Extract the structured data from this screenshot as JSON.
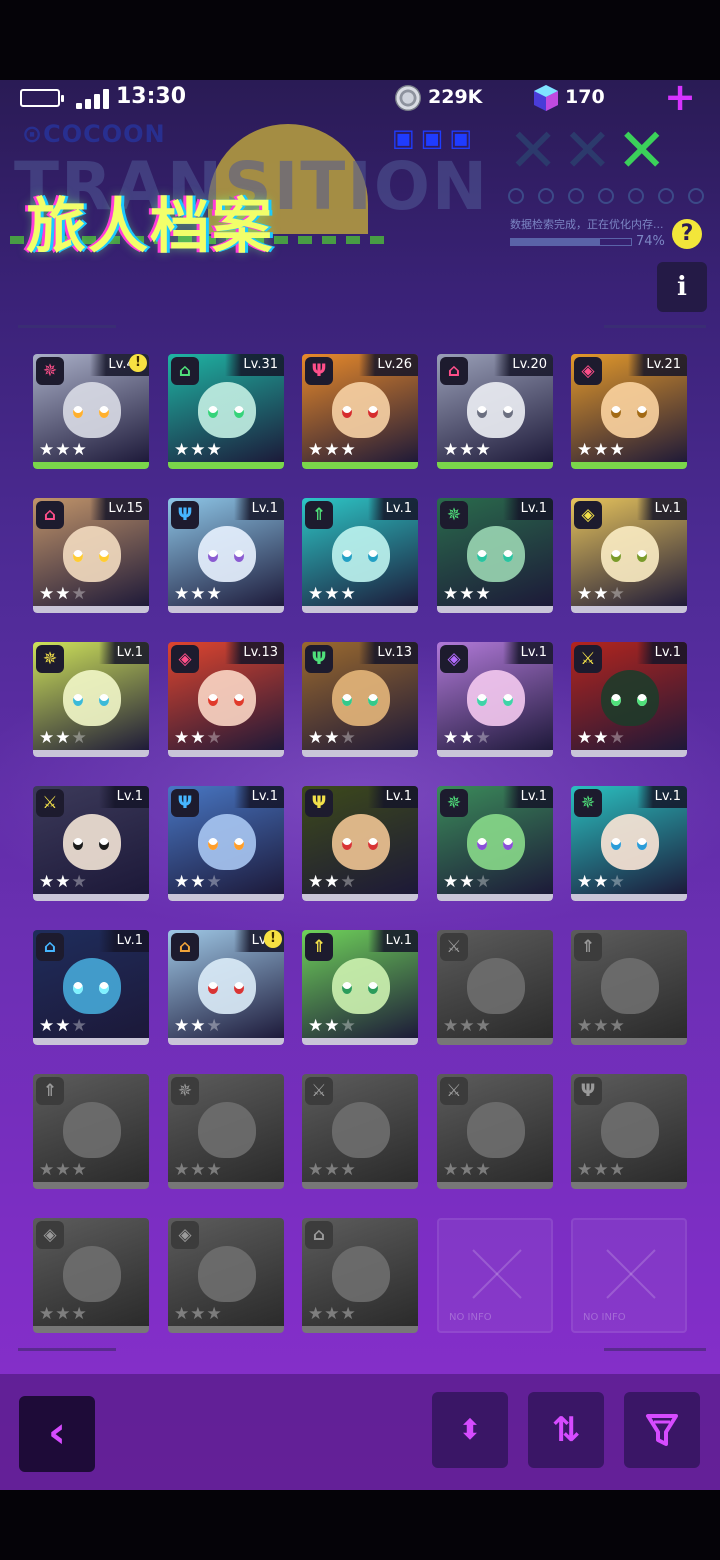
{
  "status_bar": {
    "time": "13:30",
    "coins": "229K",
    "gems": "170",
    "plus_label": "+"
  },
  "header": {
    "title": "旅人档案",
    "bg_word": "TRANSITION",
    "cocoon_label": "COCOON",
    "loading_text": "数据检索完成，正在优化内存...",
    "loading_percent": "74%",
    "loading_fraction": 0.74,
    "help_label": "?",
    "info_label": "i"
  },
  "empty_label": "NO INFO",
  "characters": [
    {
      "level": "Lv.45",
      "stars": 3,
      "role": "✵",
      "role_color": "#ff4f8a",
      "hue": "#aab0c8",
      "face": "#d9dbe6",
      "eyes": "#ffb02e",
      "alert": true,
      "green": true
    },
    {
      "level": "Lv.31",
      "stars": 3,
      "role": "⌂",
      "role_color": "#4fe07a",
      "hue": "#1fb5a4",
      "face": "#c3efe3",
      "eyes": "#35d37a",
      "alert": false,
      "green": true
    },
    {
      "level": "Lv.26",
      "stars": 3,
      "role": "Ψ",
      "role_color": "#ff4f8a",
      "hue": "#e88a2a",
      "face": "#f7d2a5",
      "eyes": "#d62c2c",
      "alert": false,
      "green": true
    },
    {
      "level": "Lv.20",
      "stars": 3,
      "role": "⌂",
      "role_color": "#ff4f8a",
      "hue": "#9aa0b8",
      "face": "#eceef4",
      "eyes": "#6b6f80",
      "alert": false,
      "green": true
    },
    {
      "level": "Lv.21",
      "stars": 3,
      "role": "◈",
      "role_color": "#ff4f8a",
      "hue": "#e59a2a",
      "face": "#fbd3a0",
      "eyes": "#a36a14",
      "alert": false,
      "green": true
    },
    {
      "level": "Lv.15",
      "stars": 2,
      "role": "⌂",
      "role_color": "#ff4f8a",
      "hue": "#c2956a",
      "face": "#f3dcc0",
      "eyes": "#ffcc33",
      "alert": false,
      "green": false
    },
    {
      "level": "Lv.1",
      "stars": 3,
      "role": "Ψ",
      "role_color": "#46b6ff",
      "hue": "#8ec7e8",
      "face": "#e8f2ff",
      "eyes": "#8a5bd1",
      "alert": false,
      "green": false
    },
    {
      "level": "Lv.1",
      "stars": 3,
      "role": "⇑",
      "role_color": "#4fe07a",
      "hue": "#2dc7c7",
      "face": "#bff4f0",
      "eyes": "#23a0c4",
      "alert": false,
      "green": false
    },
    {
      "level": "Lv.1",
      "stars": 3,
      "role": "✵",
      "role_color": "#4fe07a",
      "hue": "#2a6b4c",
      "face": "#9ad6b3",
      "eyes": "#2ac4a0",
      "alert": false,
      "green": false
    },
    {
      "level": "Lv.1",
      "stars": 2,
      "role": "◈",
      "role_color": "#f2e04a",
      "hue": "#e7c45c",
      "face": "#fbecc3",
      "eyes": "#7a9b2a",
      "alert": false,
      "green": false
    },
    {
      "level": "Lv.1",
      "stars": 2,
      "role": "✵",
      "role_color": "#f2e04a",
      "hue": "#cfe35a",
      "face": "#f2f7c8",
      "eyes": "#3bbad8",
      "alert": false,
      "green": false
    },
    {
      "level": "Lv.13",
      "stars": 2,
      "role": "◈",
      "role_color": "#ff4f8a",
      "hue": "#e0452e",
      "face": "#fbd6c4",
      "eyes": "#e03a2a",
      "alert": false,
      "green": false
    },
    {
      "level": "Lv.13",
      "stars": 2,
      "role": "Ψ",
      "role_color": "#4fe07a",
      "hue": "#9b6a2e",
      "face": "#e4b67a",
      "eyes": "#34c98a",
      "alert": false,
      "green": false
    },
    {
      "level": "Lv.1",
      "stars": 2,
      "role": "◈",
      "role_color": "#b36bff",
      "hue": "#b27ad9",
      "face": "#f4c9f0",
      "eyes": "#3fd3a8",
      "alert": false,
      "green": false
    },
    {
      "level": "Lv.1",
      "stars": 2,
      "role": "⚔",
      "role_color": "#f2e04a",
      "hue": "#b4251e",
      "face": "#1e3b2a",
      "eyes": "#4fe07a",
      "alert": false,
      "green": false
    },
    {
      "level": "Lv.1",
      "stars": 2,
      "role": "⚔",
      "role_color": "#f2e04a",
      "hue": "#3c3a5a",
      "face": "#f3e4d6",
      "eyes": "#1a1a1a",
      "alert": false,
      "green": false
    },
    {
      "level": "Lv.1",
      "stars": 2,
      "role": "Ψ",
      "role_color": "#46b6ff",
      "hue": "#4877c4",
      "face": "#a9c7f2",
      "eyes": "#ff9e2a",
      "alert": false,
      "green": false
    },
    {
      "level": "Lv.1",
      "stars": 2,
      "role": "Ψ",
      "role_color": "#f2e04a",
      "hue": "#3d4a1a",
      "face": "#f0c493",
      "eyes": "#d83434",
      "alert": false,
      "green": false
    },
    {
      "level": "Lv.1",
      "stars": 2,
      "role": "✵",
      "role_color": "#4fe07a",
      "hue": "#3b8b5a",
      "face": "#88d98a",
      "eyes": "#8a4fd8",
      "alert": false,
      "green": false
    },
    {
      "level": "Lv.1",
      "stars": 2,
      "role": "✵",
      "role_color": "#4fe07a",
      "hue": "#2ac0c0",
      "face": "#fce6d6",
      "eyes": "#2a9cd8",
      "alert": false,
      "green": false
    },
    {
      "level": "Lv.1",
      "stars": 2,
      "role": "⌂",
      "role_color": "#46b6ff",
      "hue": "#1f2d5c",
      "face": "#46a8d8",
      "eyes": "#7ff2ff",
      "alert": false,
      "green": false
    },
    {
      "level": "Lv.1",
      "stars": 2,
      "role": "⌂",
      "role_color": "#f2a43a",
      "hue": "#9fc8e6",
      "face": "#dcecf8",
      "eyes": "#d83434",
      "alert": true,
      "green": false
    },
    {
      "level": "Lv.1",
      "stars": 2,
      "role": "⇑",
      "role_color": "#f2e04a",
      "hue": "#6fd25a",
      "face": "#cdf2b0",
      "eyes": "#2a9c5a",
      "alert": false,
      "green": false
    }
  ],
  "locked_roles": [
    "⚔",
    "⇑",
    "⇑",
    "✵",
    "⚔",
    "⚔",
    "Ψ",
    "◈",
    "◈",
    "⌂"
  ],
  "empty_slots": 2,
  "bottom_bar": {
    "back_icon": "‹",
    "updown_icon": "⬍",
    "swap_icon": "⇅",
    "filter_icon": "filter-icon"
  }
}
